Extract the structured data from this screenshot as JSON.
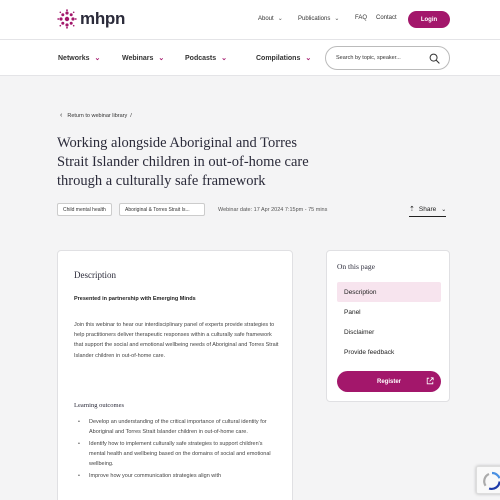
{
  "header": {
    "logo_text": "mhpn",
    "nav": [
      {
        "label": "About",
        "has_dropdown": true
      },
      {
        "label": "Publications",
        "has_dropdown": true
      },
      {
        "label": "FAQ",
        "has_dropdown": false
      },
      {
        "label": "Contact",
        "has_dropdown": false
      }
    ],
    "login_label": "Login"
  },
  "subnav": {
    "items": [
      "Networks",
      "Webinars",
      "Podcasts",
      "Compilations"
    ],
    "search_placeholder": "Search by topic, speaker..."
  },
  "breadcrumb": {
    "label": "Return to webinar library",
    "separator": "/"
  },
  "page": {
    "title": "Working alongside Aboriginal and Torres Strait Islander children in out-of-home care through a culturally safe framework",
    "tags": [
      "Child mental health",
      "Aboriginal & Torres Strait Is..."
    ],
    "webinar_date": "Webinar date: 17 Apr 2024 7:15pm - 75 mins",
    "share_label": "Share"
  },
  "description": {
    "heading": "Description",
    "partnership": "Presented in partnership with Emerging Minds",
    "paragraph": "Join this webinar to hear our interdisciplinary panel of experts provide strategies to help practitioners deliver therapeutic responses within a culturally safe framework that support the social and emotional wellbeing needs of Aboriginal and Torres Strait Islander children in out-of-home care.",
    "outcomes_heading": "Learning outcomes",
    "outcomes": [
      "Develop an understanding of the critical importance of cultural identity for Aboriginal and Torres Strait Islander children in out-of-home care.",
      "Identify how to implement culturally safe strategies to support children's mental health and wellbeing based on the domains of social and emotional wellbeing.",
      "Improve how your communication strategies align with"
    ]
  },
  "toc": {
    "heading": "On this page",
    "items": [
      "Description",
      "Panel",
      "Disclaimer",
      "Provide feedback"
    ],
    "active_index": 0,
    "register_label": "Register"
  },
  "colors": {
    "brand": "#a3176b",
    "active_bg": "#f7e4ee",
    "text_dark": "#2b2b3a"
  }
}
